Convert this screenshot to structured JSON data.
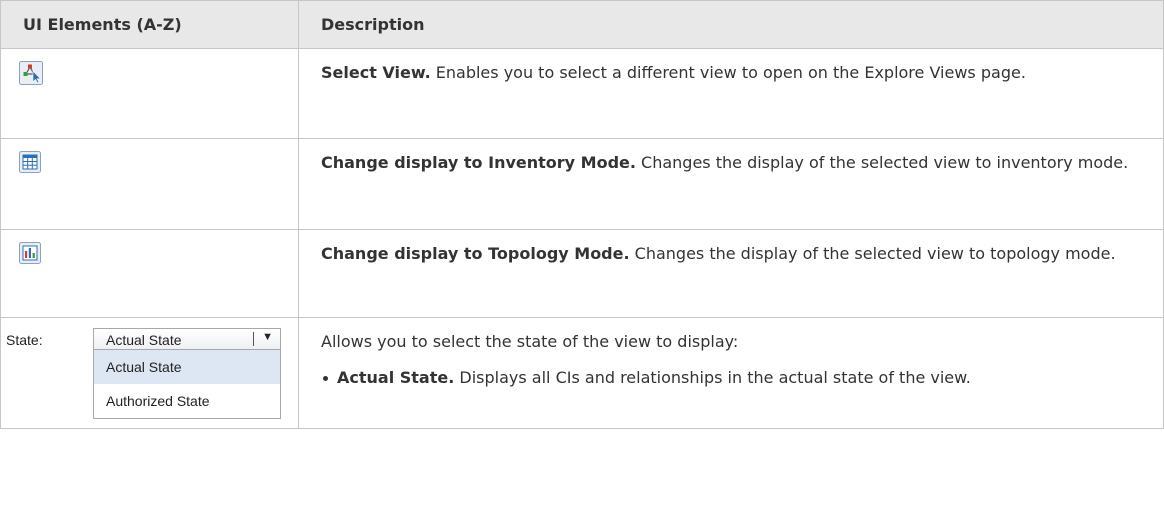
{
  "table": {
    "headers": {
      "ui": "UI Elements (A-Z)",
      "desc": "Description"
    },
    "rows": [
      {
        "icon": "select-view-icon",
        "title": "Select View.",
        "text": " Enables you to select a different view to open on the Explore Views page."
      },
      {
        "icon": "inventory-mode-icon",
        "title": "Change display to Inventory Mode.",
        "text": " Changes the display of the selected view to inventory mode."
      },
      {
        "icon": "topology-mode-icon",
        "title": "Change display to Topology Mode.",
        "text": " Changes the display of the selected view to topology mode."
      }
    ],
    "state_row": {
      "widget": {
        "label": "State:",
        "selected": "Actual State",
        "options": [
          "Actual State",
          "Authorized State"
        ]
      },
      "intro": "Allows you to select the state of the view to display:",
      "bullets": [
        {
          "title": "Actual State.",
          "text": " Displays all CIs and relationships in the actual state of the view."
        }
      ]
    }
  },
  "colors": {
    "header_bg": "#e8e8e8",
    "border": "#c6c6c6",
    "selected_option_bg": "#dde6f3",
    "icon_blue": "#2a6fb5"
  }
}
